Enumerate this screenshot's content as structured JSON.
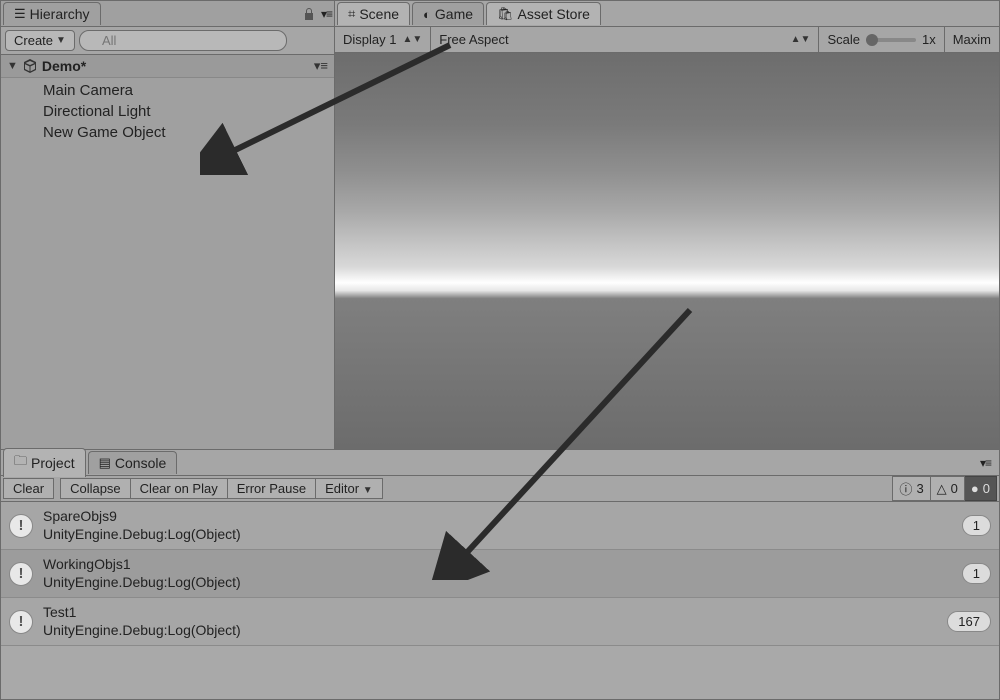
{
  "hierarchy": {
    "tab_label": "Hierarchy",
    "create_label": "Create",
    "search_placeholder": "All",
    "scene_name": "Demo*",
    "items": [
      "Main Camera",
      "Directional Light",
      "New Game Object"
    ]
  },
  "view_tabs": {
    "scene": "Scene",
    "game": "Game",
    "asset_store": "Asset Store"
  },
  "game_toolbar": {
    "display": "Display 1",
    "aspect": "Free Aspect",
    "scale_label": "Scale",
    "scale_value": "1x",
    "maximize": "Maxim"
  },
  "bottom_tabs": {
    "project": "Project",
    "console": "Console"
  },
  "console_toolbar": {
    "clear": "Clear",
    "collapse": "Collapse",
    "clear_on_play": "Clear on Play",
    "error_pause": "Error Pause",
    "editor": "Editor",
    "counts": {
      "info": "3",
      "warn": "0",
      "error": "0"
    }
  },
  "logs": [
    {
      "title": "SpareObjs9",
      "sub": "UnityEngine.Debug:Log(Object)",
      "count": "1"
    },
    {
      "title": "WorkingObjs1",
      "sub": "UnityEngine.Debug:Log(Object)",
      "count": "1"
    },
    {
      "title": "Test1",
      "sub": "UnityEngine.Debug:Log(Object)",
      "count": "167"
    }
  ]
}
